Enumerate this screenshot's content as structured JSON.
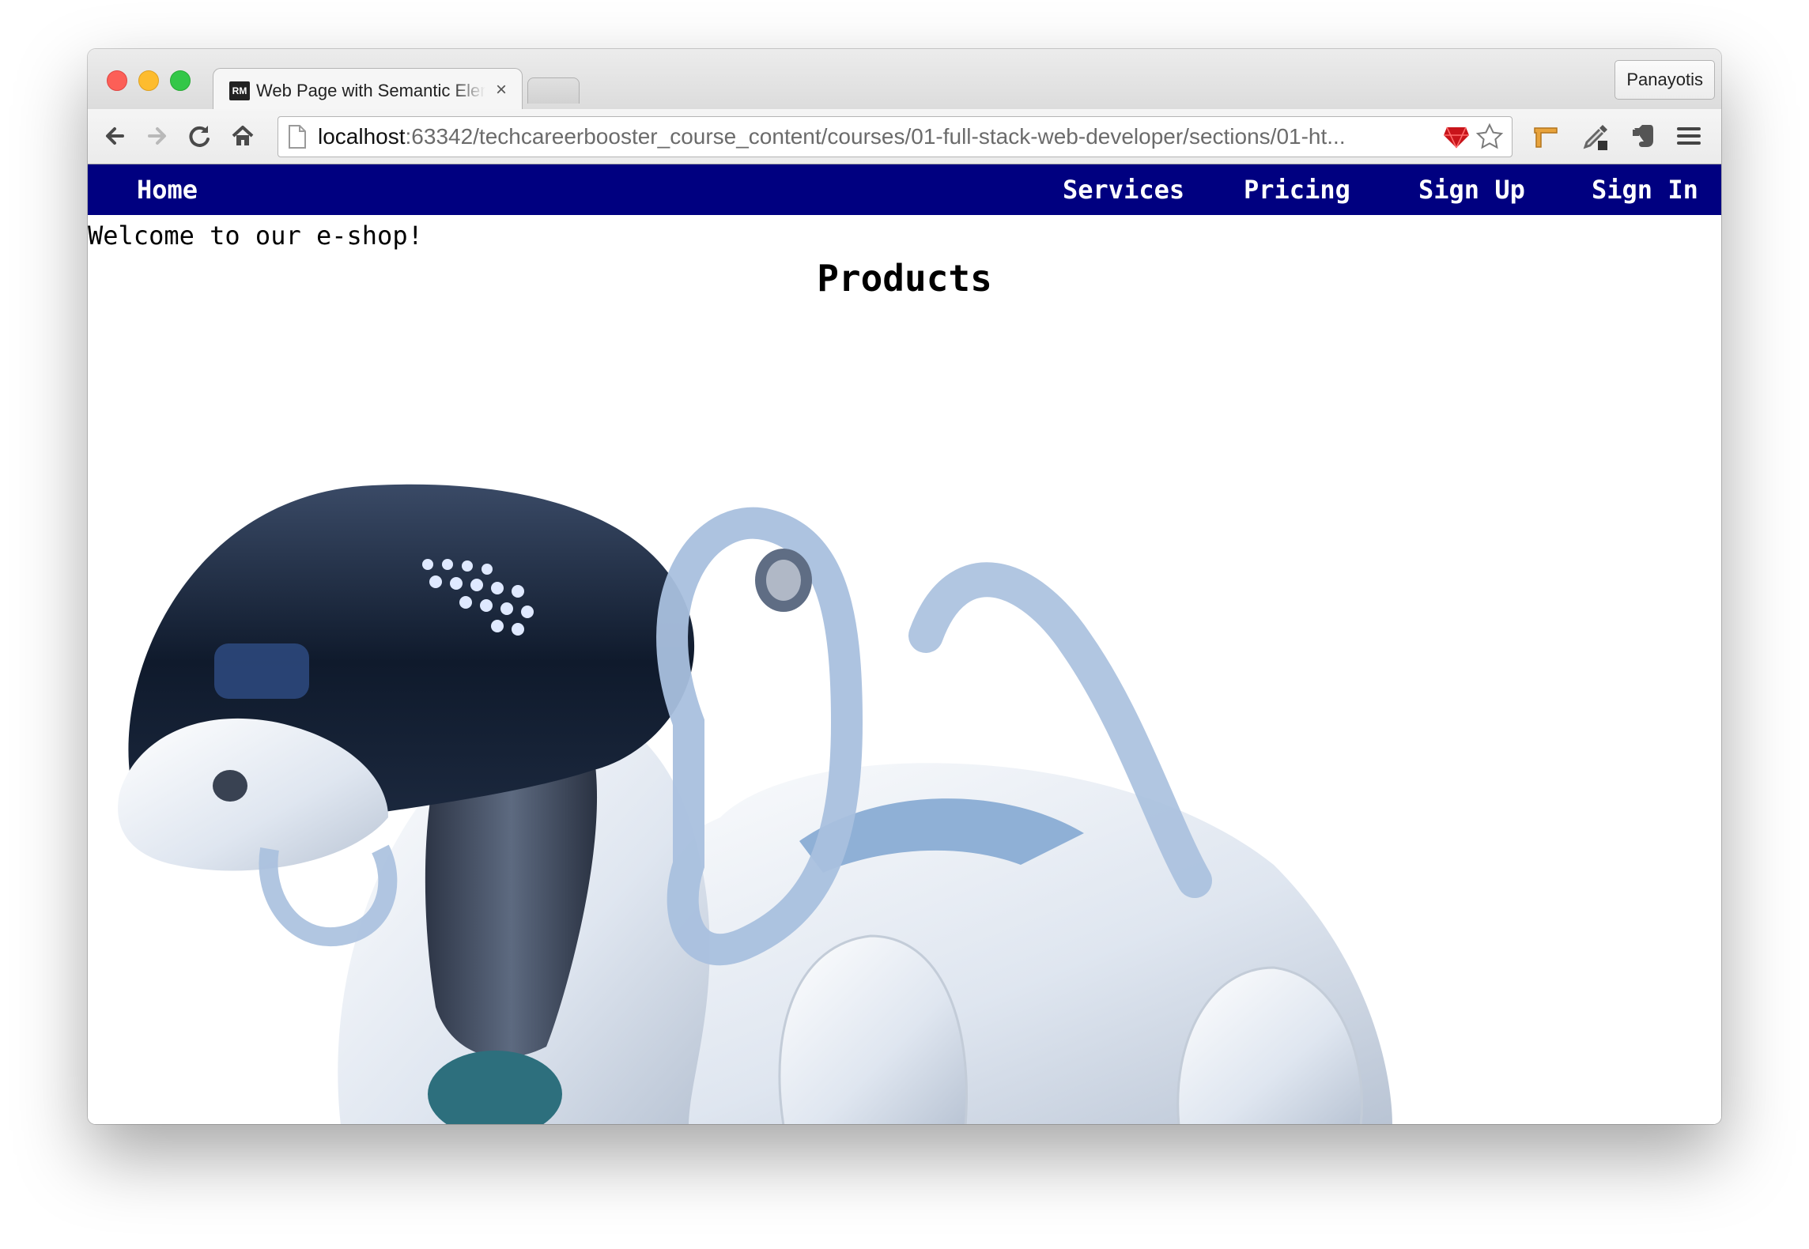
{
  "browser": {
    "tab": {
      "favicon_text": "RM",
      "title": "Web Page with Semantic Elements",
      "close_symbol": "×"
    },
    "profile_name": "Panayotis",
    "address_bar": {
      "host": "localhost",
      "rest": ":63342/techcareerbooster_course_content/courses/01-full-stack-web-developer/sections/01-ht..."
    }
  },
  "page": {
    "nav": {
      "home": "Home",
      "services": "Services",
      "pricing": "Pricing",
      "sign_up": "Sign Up",
      "sign_in": "Sign In",
      "background": "#000080"
    },
    "welcome": "Welcome to our e-shop!",
    "heading": "Products",
    "image": "robot-dog-product-image"
  }
}
